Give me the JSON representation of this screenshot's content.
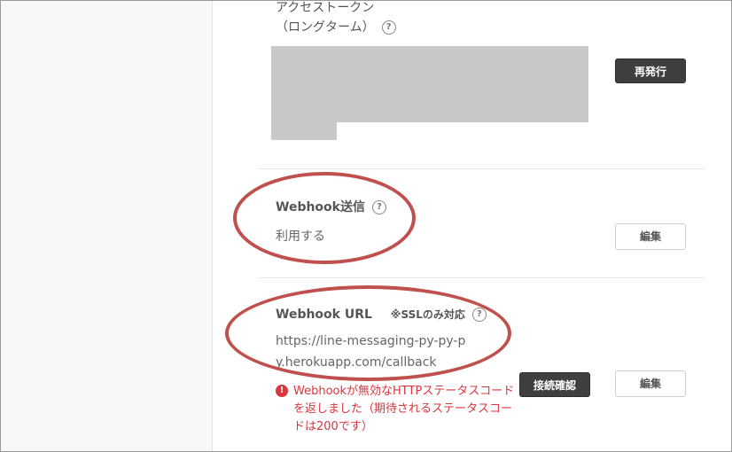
{
  "access_token": {
    "title_line1": "アクセストークン",
    "title_line2": "（ロングターム）",
    "reissue_button": "再発行"
  },
  "webhook_send": {
    "title": "Webhook送信",
    "value": "利用する",
    "edit_button": "編集"
  },
  "webhook_url": {
    "title": "Webhook URL",
    "ssl_note": "※SSLのみ対応",
    "value": "https://line-messaging-py-py-py.herokuapp.com/callback",
    "verify_button": "接続確認",
    "edit_button": "編集",
    "error_message": "Webhookが無効なHTTPステータスコードを返しました（期待されるステータスコードは200です）"
  },
  "icons": {
    "help": "question-circle-icon",
    "error": "exclamation-circle-icon"
  },
  "colors": {
    "error": "#d9363e",
    "annotation": "#c0504d",
    "dark_button": "#3f3f3f",
    "masked_area": "#c8c8c8"
  }
}
